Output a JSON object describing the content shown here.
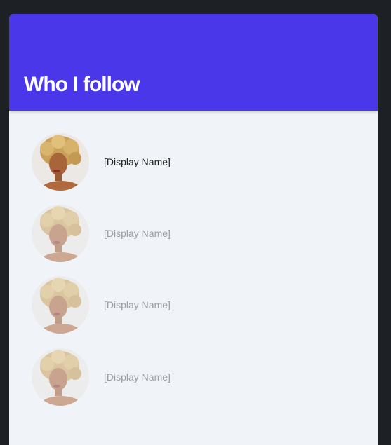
{
  "header": {
    "title": "Who I follow",
    "color": "#4a37ea"
  },
  "following": [
    {
      "display_name": "[Display Name]",
      "avatar_icon": "avatar-photo",
      "state": "active"
    },
    {
      "display_name": "[Display Name]",
      "avatar_icon": "avatar-photo",
      "state": "dimmed"
    },
    {
      "display_name": "[Display Name]",
      "avatar_icon": "avatar-photo",
      "state": "dimmed"
    },
    {
      "display_name": "[Display Name]",
      "avatar_icon": "avatar-photo",
      "state": "dimmed"
    }
  ]
}
